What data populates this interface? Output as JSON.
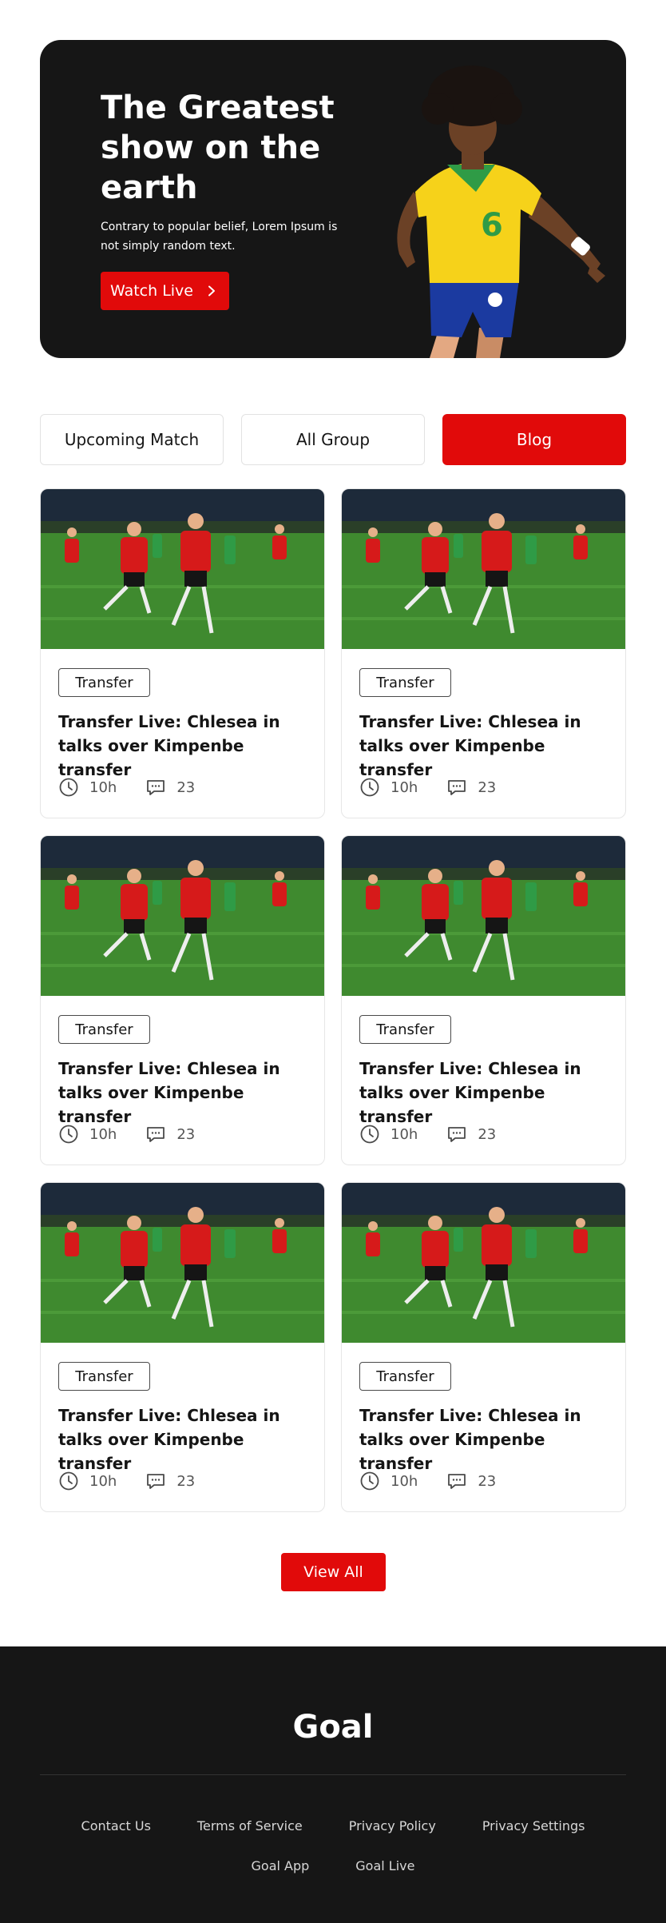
{
  "hero": {
    "title": "The Greatest show on the earth",
    "subtitle": "Contrary to popular belief, Lorem Ipsum is not simply  random text.",
    "button_label": "Watch Live",
    "button_icon": "chevron-right-icon"
  },
  "tabs": [
    {
      "label": "Upcoming Match"
    },
    {
      "label": "All Group"
    },
    {
      "label": "Blog",
      "active": true
    }
  ],
  "cards": [
    {
      "tag": "Transfer",
      "title": "Transfer Live: Chlesea in talks over Kimpenbe transfer",
      "time": "10h",
      "comments": "23"
    },
    {
      "tag": "Transfer",
      "title": "Transfer Live: Chlesea in talks over Kimpenbe transfer",
      "time": "10h",
      "comments": "23"
    },
    {
      "tag": "Transfer",
      "title": "Transfer Live: Chlesea in talks over Kimpenbe transfer",
      "time": "10h",
      "comments": "23"
    },
    {
      "tag": "Transfer",
      "title": "Transfer Live: Chlesea in talks over Kimpenbe transfer",
      "time": "10h",
      "comments": "23"
    },
    {
      "tag": "Transfer",
      "title": "Transfer Live: Chlesea in talks over Kimpenbe transfer",
      "time": "10h",
      "comments": "23"
    },
    {
      "tag": "Transfer",
      "title": "Transfer Live: Chlesea in talks over Kimpenbe transfer",
      "time": "10h",
      "comments": "23"
    }
  ],
  "view_all_label": "View All",
  "footer": {
    "logo": "Goal",
    "links_row1": [
      "Contact Us",
      "Terms of Service",
      "Privacy Policy",
      "Privacy Settings"
    ],
    "links_row2": [
      "Goal App",
      "Goal Live"
    ]
  },
  "colors": {
    "accent": "#e10a0a",
    "dark": "#161616"
  }
}
